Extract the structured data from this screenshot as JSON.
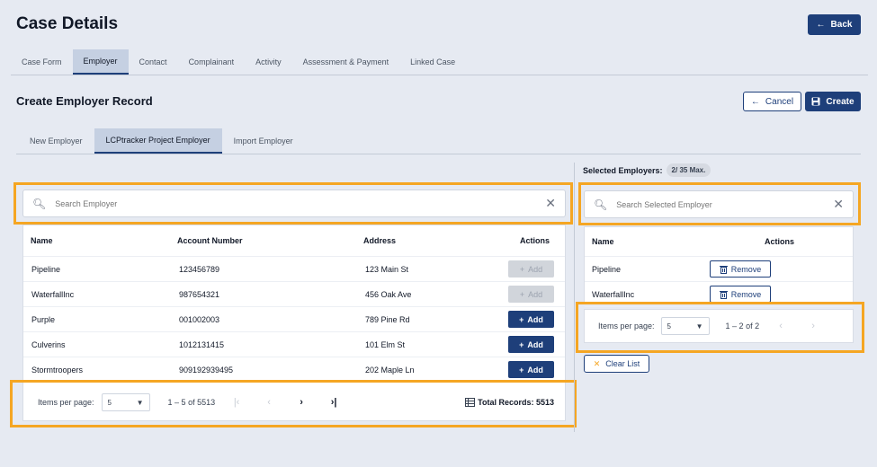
{
  "page": {
    "title": "Case Details",
    "back_label": "Back"
  },
  "main_tabs": [
    "Case Form",
    "Employer",
    "Contact",
    "Complainant",
    "Activity",
    "Assessment & Payment",
    "Linked Case"
  ],
  "section": {
    "title": "Create Employer Record",
    "cancel_label": "Cancel",
    "create_label": "Create"
  },
  "sub_tabs": [
    "New Employer",
    "LCPtracker Project Employer",
    "Import Employer"
  ],
  "employer_search": {
    "placeholder": "Search Employer"
  },
  "employer_table": {
    "columns": {
      "name": "Name",
      "account": "Account Number",
      "address": "Address",
      "actions": "Actions"
    },
    "add_label": "Add",
    "rows": [
      {
        "name": "Pipeline",
        "account": "123456789",
        "address": "123 Main St",
        "enabled": false
      },
      {
        "name": "WaterfallInc",
        "account": "987654321",
        "address": "456 Oak Ave",
        "enabled": false
      },
      {
        "name": "Purple",
        "account": "001002003",
        "address": "789 Pine Rd",
        "enabled": true
      },
      {
        "name": "Culverins",
        "account": "1012131415",
        "address": "101 Elm St",
        "enabled": true
      },
      {
        "name": "Stormtroopers",
        "account": "909192939495",
        "address": "202 Maple Ln",
        "enabled": true
      }
    ]
  },
  "employer_pager": {
    "label": "Items per page:",
    "size": "5",
    "range": "1 – 5 of 5513",
    "total": "Total Records: 5513"
  },
  "selected": {
    "label": "Selected Employers:",
    "count": "2/ 35 Max.",
    "search_placeholder": "Search Selected Employer",
    "columns": {
      "name": "Name",
      "actions": "Actions"
    },
    "remove_label": "Remove",
    "rows": [
      "Pipeline",
      "WaterfallInc"
    ],
    "pager": {
      "label": "Items per page:",
      "size": "5",
      "range": "1 – 2 of 2"
    },
    "clear_label": "Clear List"
  },
  "colors": {
    "primary": "#1e3f7a",
    "highlight": "#f5a623",
    "background": "#e6eaf2"
  }
}
